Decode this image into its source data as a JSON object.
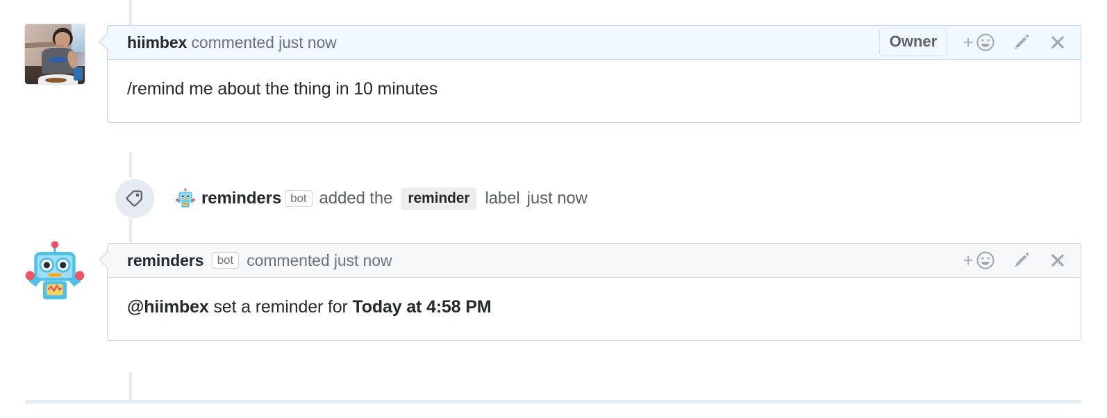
{
  "theme": {
    "blue_header_bg": "#f1f8ff",
    "blue_border": "#c0d3eb",
    "gray_header_bg": "#f6f8fa",
    "gray_border": "#d1d5da",
    "rail_color": "#e6ebf1",
    "text_primary": "#24292e",
    "text_muted": "#6a737d",
    "label_chip_bg": "#ededed",
    "robot_body": "#4fc0e8",
    "robot_accent": "#ed5565"
  },
  "timeline": [
    {
      "type": "comment",
      "variant": "blue",
      "avatar": {
        "name": "hiimbex-avatar",
        "kind": "photo"
      },
      "header": {
        "author": "hiimbex",
        "action": "commented",
        "timestamp": "just now",
        "badge": "Owner",
        "actions": [
          {
            "name": "add-reaction-button",
            "icon": "plus-smiley-icon",
            "label": "+"
          },
          {
            "name": "edit-comment-button",
            "icon": "pencil-icon"
          },
          {
            "name": "delete-comment-button",
            "icon": "close-icon"
          }
        ]
      },
      "body": {
        "text": "/remind me about the thing in 10 minutes"
      }
    },
    {
      "type": "label-event",
      "icon": "tag-icon",
      "author": "reminders",
      "author_kind_badge": "bot",
      "avatar_icon": "robot-icon",
      "action_prefix": "added the",
      "label": "reminder",
      "action_suffix": "label",
      "timestamp": "just now"
    },
    {
      "type": "comment",
      "variant": "gray",
      "avatar": {
        "name": "reminders-bot-avatar",
        "kind": "robot"
      },
      "header": {
        "author": "reminders",
        "author_kind_badge": "bot",
        "action": "commented",
        "timestamp": "just now",
        "actions": [
          {
            "name": "add-reaction-button",
            "icon": "plus-smiley-icon",
            "label": "+"
          },
          {
            "name": "edit-comment-button",
            "icon": "pencil-icon"
          },
          {
            "name": "delete-comment-button",
            "icon": "close-icon"
          }
        ]
      },
      "body": {
        "mention": "@hiimbex",
        "middle": " set a reminder for ",
        "datetime": "Today at 4:58 PM"
      }
    }
  ]
}
